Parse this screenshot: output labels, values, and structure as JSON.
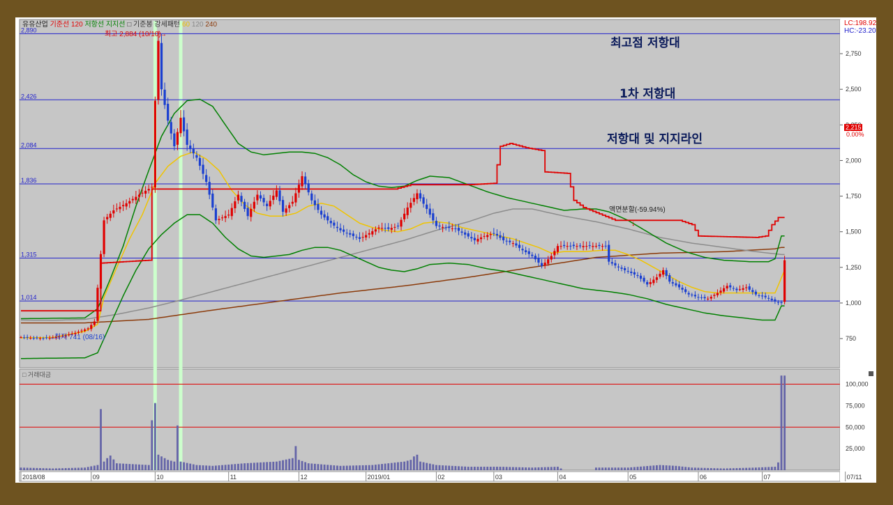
{
  "header": {
    "stock_name": "유유산업",
    "legend_items": [
      {
        "label": "기준선 120",
        "color": "#e00000"
      },
      {
        "label": "저항선",
        "color": "#008000"
      },
      {
        "label": "지지선",
        "color": "#008000"
      },
      {
        "label": "□ 기준봉 강세패턴",
        "color": "#333333"
      },
      {
        "label": "60",
        "color": "#e8c000"
      },
      {
        "label": "120",
        "color": "#888888"
      },
      {
        "label": "240",
        "color": "#8b3a0a"
      }
    ],
    "lc_label": "LC:198.92",
    "hc_label": "HC:-23.20"
  },
  "annotations": {
    "high_label": "최고 2,884 (10/10)",
    "low_label": "최저 741 (08/16)",
    "split_label": "액면분할(-59.94%)",
    "resist_top": "최고점 저항대",
    "resist_first": "1차 저항대",
    "resist_support": "저항대 및 지지라인",
    "current_price": "2,215",
    "current_pct": "0.00%"
  },
  "volume_panel": {
    "title": "□ 거래대금"
  },
  "colors": {
    "up": "#e00000",
    "down": "#1a3fd0",
    "ma60": "#f0c400",
    "ma120": "#8c8c8c",
    "ma240": "#8b3a0a",
    "band": "#008000",
    "baseline": "#e00000",
    "hline": "#2222cc",
    "highlight": "#ccffcc"
  },
  "chart_data": {
    "type": "candlestick",
    "price_yticks": [
      750,
      1000,
      1250,
      1500,
      1750,
      2000,
      2250,
      2500,
      2750
    ],
    "volume_yticks": [
      25000,
      50000,
      75000,
      100000
    ],
    "ylim": [
      550,
      2980
    ],
    "volume_ylim": [
      0,
      115000
    ],
    "xticks": [
      {
        "label": "2018/08",
        "i": 0
      },
      {
        "label": "09",
        "i": 22
      },
      {
        "label": "10",
        "i": 42
      },
      {
        "label": "11",
        "i": 65
      },
      {
        "label": "12",
        "i": 87
      },
      {
        "label": "2019/01",
        "i": 108
      },
      {
        "label": "02",
        "i": 130
      },
      {
        "label": "03",
        "i": 148
      },
      {
        "label": "04",
        "i": 168
      },
      {
        "label": "05",
        "i": 190
      },
      {
        "label": "06",
        "i": 212
      },
      {
        "label": "07",
        "i": 232
      },
      {
        "label": "07/11",
        "i": 258
      }
    ],
    "hlines": [
      {
        "value": 2890,
        "label": "2,890"
      },
      {
        "value": 2426,
        "label": "2,426"
      },
      {
        "value": 2084,
        "label": "2,084"
      },
      {
        "value": 1836,
        "label": "1,836"
      },
      {
        "value": 1315,
        "label": "1,315"
      },
      {
        "value": 1014,
        "label": "1,014"
      }
    ],
    "highlight_bars": [
      42,
      50
    ],
    "closes_anchor": [
      [
        0,
        760
      ],
      [
        5,
        752
      ],
      [
        9,
        755
      ],
      [
        13,
        768
      ],
      [
        17,
        790
      ],
      [
        21,
        822
      ],
      [
        23,
        870
      ],
      [
        26,
        1580
      ],
      [
        29,
        1650
      ],
      [
        33,
        1700
      ],
      [
        37,
        1760
      ],
      [
        41,
        1815
      ],
      [
        42,
        2420
      ],
      [
        43,
        2840
      ],
      [
        44,
        2500
      ],
      [
        46,
        2280
      ],
      [
        48,
        2100
      ],
      [
        50,
        2300
      ],
      [
        52,
        2110
      ],
      [
        55,
        2020
      ],
      [
        58,
        1850
      ],
      [
        61,
        1580
      ],
      [
        65,
        1620
      ],
      [
        68,
        1760
      ],
      [
        71,
        1610
      ],
      [
        74,
        1760
      ],
      [
        77,
        1680
      ],
      [
        80,
        1790
      ],
      [
        82,
        1640
      ],
      [
        85,
        1710
      ],
      [
        88,
        1890
      ],
      [
        91,
        1720
      ],
      [
        94,
        1620
      ],
      [
        97,
        1560
      ],
      [
        100,
        1510
      ],
      [
        103,
        1480
      ],
      [
        106,
        1450
      ],
      [
        109,
        1490
      ],
      [
        112,
        1530
      ],
      [
        115,
        1520
      ],
      [
        118,
        1540
      ],
      [
        121,
        1670
      ],
      [
        124,
        1770
      ],
      [
        127,
        1660
      ],
      [
        130,
        1540
      ],
      [
        133,
        1530
      ],
      [
        136,
        1520
      ],
      [
        139,
        1480
      ],
      [
        142,
        1440
      ],
      [
        145,
        1470
      ],
      [
        148,
        1490
      ],
      [
        151,
        1440
      ],
      [
        154,
        1420
      ],
      [
        157,
        1370
      ],
      [
        160,
        1330
      ],
      [
        163,
        1260
      ],
      [
        166,
        1330
      ],
      [
        168,
        1400
      ],
      [
        183,
        1400
      ],
      [
        184,
        1290
      ],
      [
        187,
        1250
      ],
      [
        190,
        1220
      ],
      [
        193,
        1190
      ],
      [
        196,
        1130
      ],
      [
        199,
        1180
      ],
      [
        201,
        1230
      ],
      [
        203,
        1150
      ],
      [
        206,
        1110
      ],
      [
        209,
        1060
      ],
      [
        212,
        1040
      ],
      [
        215,
        1030
      ],
      [
        218,
        1070
      ],
      [
        221,
        1120
      ],
      [
        224,
        1090
      ],
      [
        227,
        1110
      ],
      [
        230,
        1060
      ],
      [
        233,
        1040
      ],
      [
        236,
        1010
      ],
      [
        238,
        1000
      ],
      [
        239,
        1300
      ]
    ],
    "volume_anchor": [
      [
        0,
        3
      ],
      [
        10,
        2
      ],
      [
        20,
        3
      ],
      [
        24,
        6
      ],
      [
        25,
        71
      ],
      [
        26,
        10
      ],
      [
        27,
        14
      ],
      [
        28,
        17
      ],
      [
        30,
        8
      ],
      [
        40,
        6
      ],
      [
        41,
        58
      ],
      [
        42,
        78
      ],
      [
        43,
        18
      ],
      [
        44,
        16
      ],
      [
        46,
        12
      ],
      [
        48,
        10
      ],
      [
        49,
        52
      ],
      [
        50,
        10
      ],
      [
        55,
        6
      ],
      [
        60,
        5
      ],
      [
        70,
        8
      ],
      [
        80,
        10
      ],
      [
        85,
        14
      ],
      [
        86,
        28
      ],
      [
        87,
        12
      ],
      [
        90,
        8
      ],
      [
        100,
        5
      ],
      [
        110,
        6
      ],
      [
        120,
        10
      ],
      [
        122,
        12
      ],
      [
        123,
        16
      ],
      [
        124,
        18
      ],
      [
        125,
        10
      ],
      [
        130,
        6
      ],
      [
        140,
        4
      ],
      [
        150,
        4
      ],
      [
        160,
        3
      ],
      [
        168,
        4
      ],
      [
        170,
        0
      ],
      [
        179,
        0
      ],
      [
        180,
        3
      ],
      [
        190,
        3
      ],
      [
        200,
        6
      ],
      [
        205,
        5
      ],
      [
        210,
        3
      ],
      [
        220,
        2
      ],
      [
        230,
        3
      ],
      [
        236,
        4
      ],
      [
        237,
        9
      ],
      [
        238,
        110
      ]
    ],
    "baseline_anchor": [
      [
        0,
        945
      ],
      [
        24,
        945
      ],
      [
        25,
        1280
      ],
      [
        40,
        1300
      ],
      [
        41,
        1800
      ],
      [
        117,
        1800
      ],
      [
        122,
        1830
      ],
      [
        140,
        1830
      ],
      [
        148,
        1840
      ],
      [
        150,
        2100
      ],
      [
        153,
        2120
      ],
      [
        158,
        2090
      ],
      [
        163,
        2070
      ],
      [
        164,
        1920
      ],
      [
        171,
        1910
      ],
      [
        173,
        1720
      ],
      [
        176,
        1670
      ],
      [
        186,
        1580
      ],
      [
        206,
        1580
      ],
      [
        210,
        1550
      ],
      [
        212,
        1470
      ],
      [
        230,
        1460
      ],
      [
        233,
        1470
      ],
      [
        235,
        1550
      ],
      [
        237,
        1600
      ]
    ],
    "ma60_anchor": [
      [
        0,
        755
      ],
      [
        10,
        758
      ],
      [
        20,
        800
      ],
      [
        24,
        850
      ],
      [
        26,
        1040
      ],
      [
        30,
        1250
      ],
      [
        34,
        1450
      ],
      [
        38,
        1620
      ],
      [
        42,
        1840
      ],
      [
        46,
        1960
      ],
      [
        50,
        2030
      ],
      [
        54,
        2060
      ],
      [
        58,
        2010
      ],
      [
        62,
        1930
      ],
      [
        66,
        1790
      ],
      [
        70,
        1690
      ],
      [
        74,
        1630
      ],
      [
        78,
        1610
      ],
      [
        82,
        1610
      ],
      [
        86,
        1630
      ],
      [
        90,
        1680
      ],
      [
        94,
        1700
      ],
      [
        98,
        1680
      ],
      [
        102,
        1620
      ],
      [
        106,
        1560
      ],
      [
        110,
        1530
      ],
      [
        114,
        1510
      ],
      [
        118,
        1500
      ],
      [
        122,
        1520
      ],
      [
        126,
        1560
      ],
      [
        130,
        1570
      ],
      [
        134,
        1560
      ],
      [
        138,
        1530
      ],
      [
        142,
        1510
      ],
      [
        146,
        1490
      ],
      [
        150,
        1470
      ],
      [
        154,
        1450
      ],
      [
        158,
        1420
      ],
      [
        162,
        1390
      ],
      [
        166,
        1350
      ],
      [
        170,
        1360
      ],
      [
        176,
        1360
      ],
      [
        182,
        1370
      ],
      [
        186,
        1370
      ],
      [
        190,
        1340
      ],
      [
        194,
        1300
      ],
      [
        198,
        1250
      ],
      [
        202,
        1200
      ],
      [
        206,
        1150
      ],
      [
        210,
        1110
      ],
      [
        214,
        1080
      ],
      [
        218,
        1070
      ],
      [
        222,
        1070
      ],
      [
        226,
        1070
      ],
      [
        230,
        1070
      ],
      [
        236,
        1070
      ],
      [
        239,
        1230
      ]
    ],
    "ma120_anchor": [
      [
        0,
        880
      ],
      [
        10,
        878
      ],
      [
        20,
        885
      ],
      [
        30,
        920
      ],
      [
        40,
        965
      ],
      [
        50,
        1020
      ],
      [
        60,
        1080
      ],
      [
        70,
        1140
      ],
      [
        80,
        1200
      ],
      [
        90,
        1260
      ],
      [
        100,
        1320
      ],
      [
        110,
        1380
      ],
      [
        120,
        1440
      ],
      [
        130,
        1510
      ],
      [
        140,
        1570
      ],
      [
        148,
        1630
      ],
      [
        154,
        1660
      ],
      [
        160,
        1660
      ],
      [
        170,
        1610
      ],
      [
        180,
        1570
      ],
      [
        190,
        1520
      ],
      [
        200,
        1460
      ],
      [
        210,
        1420
      ],
      [
        220,
        1390
      ],
      [
        230,
        1360
      ],
      [
        238,
        1340
      ]
    ],
    "ma240_anchor": [
      [
        0,
        860
      ],
      [
        20,
        860
      ],
      [
        40,
        885
      ],
      [
        60,
        950
      ],
      [
        80,
        1010
      ],
      [
        100,
        1070
      ],
      [
        120,
        1120
      ],
      [
        140,
        1180
      ],
      [
        160,
        1250
      ],
      [
        180,
        1320
      ],
      [
        200,
        1350
      ],
      [
        220,
        1360
      ],
      [
        236,
        1380
      ],
      [
        238,
        1390
      ]
    ],
    "upper_band_anchor": [
      [
        0,
        890
      ],
      [
        20,
        895
      ],
      [
        24,
        960
      ],
      [
        28,
        1170
      ],
      [
        32,
        1400
      ],
      [
        36,
        1680
      ],
      [
        40,
        1930
      ],
      [
        44,
        2170
      ],
      [
        48,
        2330
      ],
      [
        52,
        2420
      ],
      [
        56,
        2430
      ],
      [
        60,
        2380
      ],
      [
        64,
        2250
      ],
      [
        68,
        2120
      ],
      [
        72,
        2060
      ],
      [
        76,
        2040
      ],
      [
        80,
        2050
      ],
      [
        84,
        2060
      ],
      [
        88,
        2060
      ],
      [
        92,
        2050
      ],
      [
        96,
        2020
      ],
      [
        100,
        1970
      ],
      [
        104,
        1900
      ],
      [
        108,
        1850
      ],
      [
        112,
        1820
      ],
      [
        116,
        1810
      ],
      [
        120,
        1820
      ],
      [
        124,
        1860
      ],
      [
        128,
        1890
      ],
      [
        134,
        1880
      ],
      [
        140,
        1830
      ],
      [
        146,
        1780
      ],
      [
        152,
        1740
      ],
      [
        158,
        1710
      ],
      [
        164,
        1680
      ],
      [
        170,
        1650
      ],
      [
        176,
        1660
      ],
      [
        180,
        1660
      ],
      [
        184,
        1640
      ],
      [
        190,
        1580
      ],
      [
        196,
        1500
      ],
      [
        202,
        1420
      ],
      [
        208,
        1360
      ],
      [
        214,
        1320
      ],
      [
        220,
        1300
      ],
      [
        228,
        1290
      ],
      [
        234,
        1290
      ],
      [
        236,
        1310
      ],
      [
        238,
        1470
      ]
    ],
    "lower_band_anchor": [
      [
        0,
        610
      ],
      [
        20,
        615
      ],
      [
        24,
        650
      ],
      [
        28,
        850
      ],
      [
        32,
        1050
      ],
      [
        36,
        1230
      ],
      [
        40,
        1380
      ],
      [
        44,
        1480
      ],
      [
        48,
        1560
      ],
      [
        52,
        1620
      ],
      [
        56,
        1620
      ],
      [
        60,
        1560
      ],
      [
        64,
        1460
      ],
      [
        68,
        1380
      ],
      [
        72,
        1330
      ],
      [
        76,
        1320
      ],
      [
        80,
        1330
      ],
      [
        84,
        1340
      ],
      [
        88,
        1370
      ],
      [
        92,
        1390
      ],
      [
        96,
        1390
      ],
      [
        100,
        1370
      ],
      [
        104,
        1330
      ],
      [
        108,
        1290
      ],
      [
        112,
        1250
      ],
      [
        116,
        1230
      ],
      [
        120,
        1220
      ],
      [
        124,
        1240
      ],
      [
        128,
        1270
      ],
      [
        134,
        1280
      ],
      [
        140,
        1270
      ],
      [
        146,
        1240
      ],
      [
        152,
        1220
      ],
      [
        158,
        1190
      ],
      [
        164,
        1160
      ],
      [
        170,
        1130
      ],
      [
        176,
        1100
      ],
      [
        180,
        1090
      ],
      [
        184,
        1080
      ],
      [
        190,
        1060
      ],
      [
        196,
        1030
      ],
      [
        202,
        990
      ],
      [
        208,
        960
      ],
      [
        214,
        930
      ],
      [
        220,
        910
      ],
      [
        228,
        890
      ],
      [
        232,
        880
      ],
      [
        236,
        880
      ],
      [
        238,
        980
      ]
    ]
  }
}
